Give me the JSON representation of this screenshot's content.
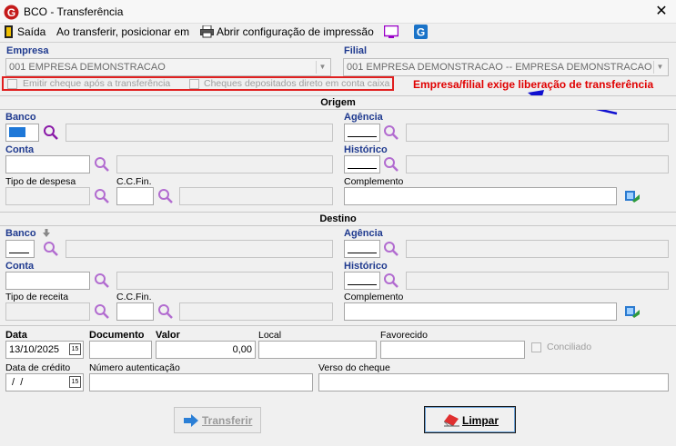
{
  "window": {
    "title": "BCO - Transferência",
    "close_glyph": "✕"
  },
  "toolbar": {
    "exit_label": "Saída",
    "transfer_position_label": "Ao transferir, posicionar em",
    "print_config_label": "Abrir configuração de impressão"
  },
  "company": {
    "empresa_label": "Empresa",
    "empresa_value": "001 EMPRESA DEMONSTRACAO",
    "filial_label": "Filial",
    "filial_value": "001 EMPRESA DEMONSTRACAO -- EMPRESA DEMONSTRACAO",
    "check_emit_label": "Emitir cheque após a transferência",
    "check_deposit_label": "Cheques depositados direto em conta caixa",
    "warning_text": "Empresa/filial exige liberação de transferência",
    "warning_color": "#e00000",
    "highlight_color": "#e02020",
    "arrow_color": "#1010d0"
  },
  "origem": {
    "section_label": "Origem",
    "banco_label": "Banco",
    "agencia_label": "Agência",
    "conta_label": "Conta",
    "historico_label": "Histórico",
    "tipo_label": "Tipo de despesa",
    "ccfin_label": "C.C.Fin.",
    "complemento_label": "Complemento"
  },
  "destino": {
    "section_label": "Destino",
    "banco_label": "Banco",
    "agencia_label": "Agência",
    "conta_label": "Conta",
    "historico_label": "Histórico",
    "tipo_label": "Tipo de receita",
    "ccfin_label": "C.C.Fin.",
    "complemento_label": "Complemento"
  },
  "footer": {
    "data_label": "Data",
    "data_value": "13/10/2025",
    "documento_label": "Documento",
    "valor_label": "Valor",
    "valor_value": "0,00",
    "local_label": "Local",
    "favorecido_label": "Favorecido",
    "conciliado_label": "Conciliado",
    "data_credito_label": "Data de crédito",
    "data_credito_value": " /  /",
    "autenticacao_label": "Número autenticação",
    "verso_label": "Verso do cheque"
  },
  "buttons": {
    "transferir_label": "Transferir",
    "limpar_label": "Limpar"
  }
}
